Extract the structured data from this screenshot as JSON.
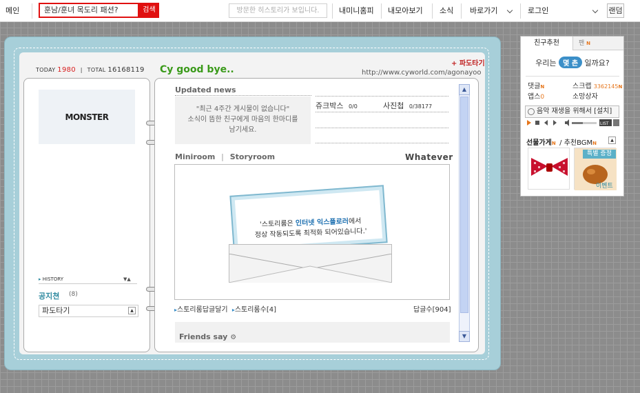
{
  "topbar": {
    "main": "메인",
    "search_value": "훈남/훈녀 목도리 패션?",
    "search_btn": "검색",
    "history_placeholder": "방문한 히스토리가 보입니다.",
    "my_minihompy": "내미니홈피",
    "my_collection": "내모아보기",
    "news": "소식",
    "shortcut": "바로가기",
    "login": "로그인",
    "random": "랜덤"
  },
  "profile": {
    "today_label": "TODAY",
    "today_count": "1980",
    "total_label": "TOTAL",
    "total_count": "16168119",
    "title": "Cy good bye..",
    "paper_top": "파도타기",
    "url": "http://www.cyworld.com/agonayoo",
    "logo_text": "MONSTER",
    "history_label": "HISTORY",
    "notice_title": "공지쳔",
    "notice_count": "(8)",
    "surf_select": "파도타기"
  },
  "main": {
    "updated_news_title": "Updated news",
    "news_empty": [
      "\"최근 4주간 게시물이 없습니다\"",
      "소식이 뜸한 친구에게 마음의 한마디를",
      "남기세요."
    ],
    "jukebox_label": "쥬크박스",
    "jukebox_count": "0/0",
    "album_label": "사진첩",
    "album_count": "0/38177",
    "miniroom_tab": "Miniroom",
    "storyroom_tab": "Storyroom",
    "whatever": "Whatever",
    "story_msg_1": "'스토리룸은 ",
    "story_msg_em": "인터넷 익스플로러",
    "story_msg_2": "에서",
    "story_msg_3": "정상 작동되도록 최적화 되어있습니다.'",
    "story_reply_link": "스토리룸답글달기",
    "story_count_link": "스토리룸수[4]",
    "reply_count": "답글수[904]",
    "friends_say": "Friends say"
  },
  "widget": {
    "tab_friends": "친구추천",
    "tab_fan": "팬",
    "how_1": "우리는",
    "how_badge": "몇 촌",
    "how_2": "일까요?",
    "comment": "댓글",
    "scrap": "스크랩",
    "scrap_count": "3362145",
    "apps": "앱스",
    "apps_count": "0",
    "wishbox": "소망상자",
    "music_msg": "음악 재생을 위해서 [설치]",
    "list": "LIST",
    "gift_shop": "선물가게",
    "recommend_bgm": "/ 추천BGM",
    "special": "특별 증정",
    "event": "이벤트"
  },
  "colors": {
    "accent_red": "#e01010",
    "title_green": "#3a9a1a",
    "frame_blue": "#a7cfd9",
    "new_orange": "#e6761c"
  }
}
